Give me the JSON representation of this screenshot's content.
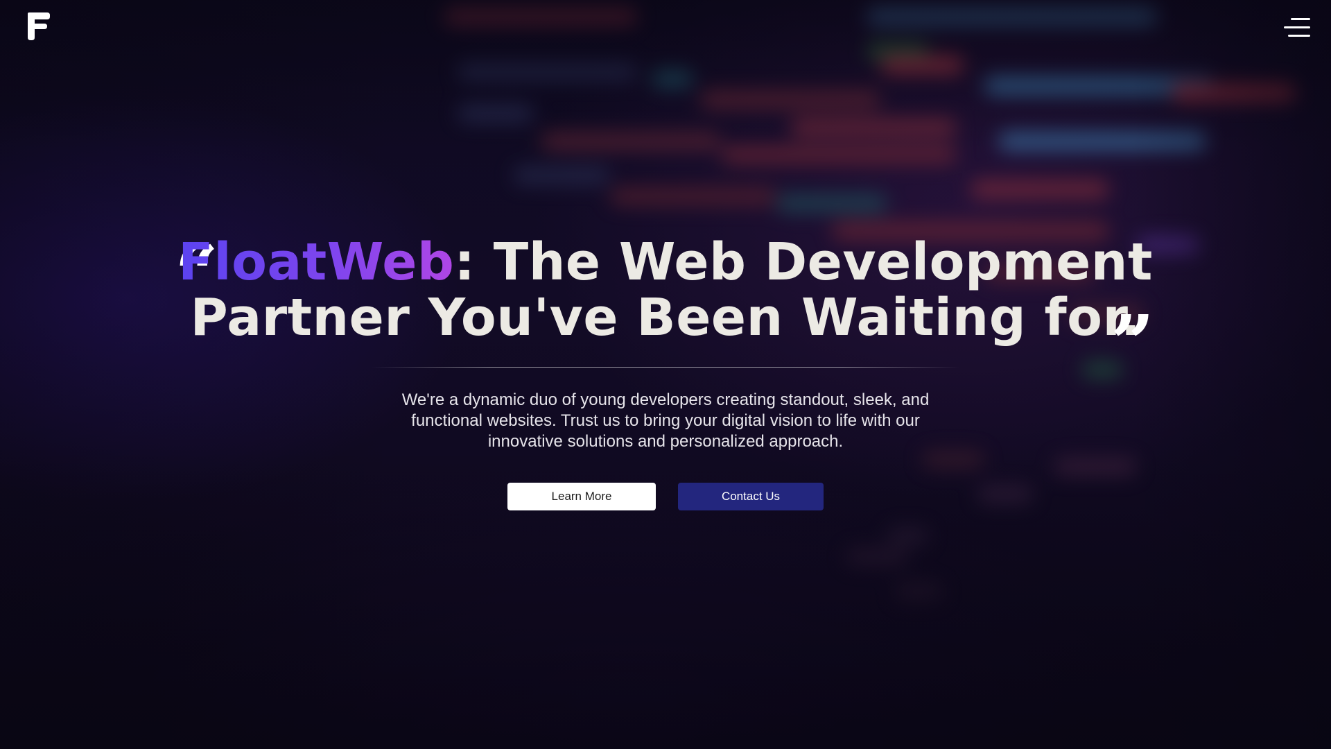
{
  "header": {
    "logo_icon": "floatweb-f-logo-icon",
    "menu_icon": "hamburger-menu-icon"
  },
  "hero": {
    "quote_open": "“",
    "brand_name": "FloatWeb",
    "headline_line1_rest": ": The Web Development",
    "headline_line2": "Partner You've Been Waiting for.",
    "quote_close": "”",
    "description": "We're a dynamic duo of young developers creating standout, sleek, and functional websites. Trust us to bring your digital vision to life with our innovative solutions and personalized approach."
  },
  "actions": {
    "learn_more": "Learn More",
    "contact_us": "Contact Us"
  },
  "colors": {
    "background": "#0b0718",
    "headline": "#eceae4",
    "brand_gradient_start": "#5b43f0",
    "brand_gradient_end": "#b046e6",
    "contact_button": "#23267e",
    "learn_button": "#ffffff"
  }
}
